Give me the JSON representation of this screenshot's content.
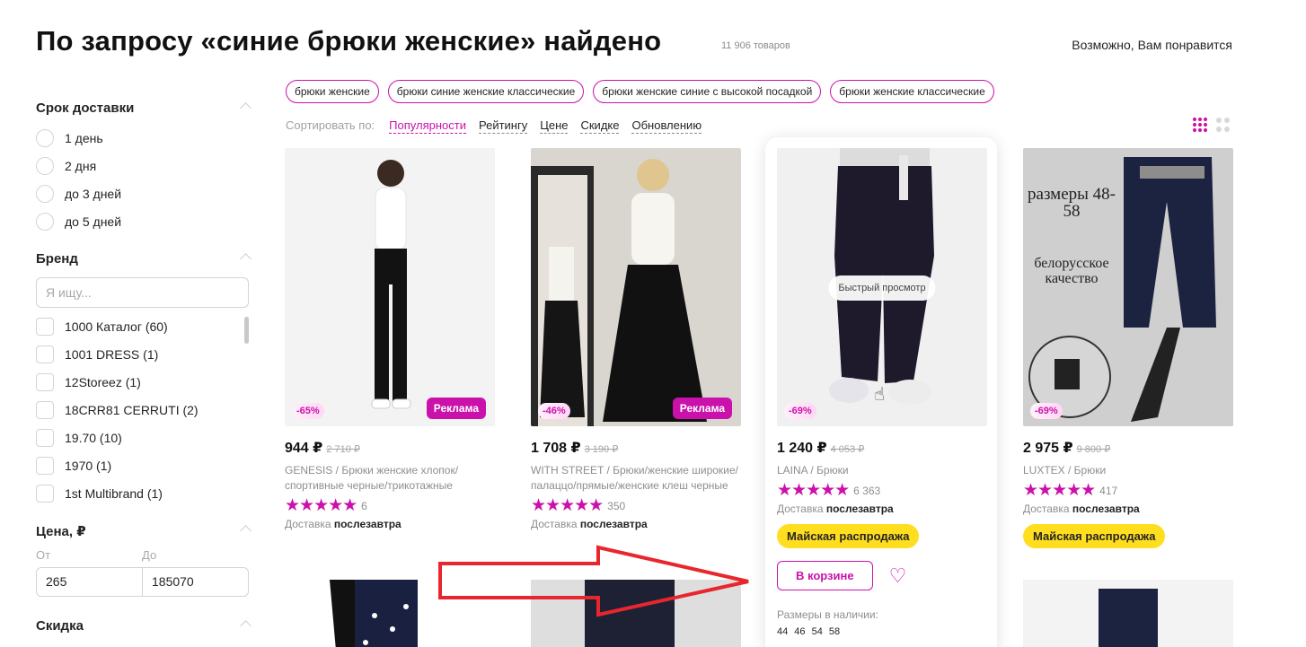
{
  "header": {
    "title": "По запросу «синие брюки женские» найдено",
    "count": "11 906 товаров",
    "maybe_like": "Возможно, Вам понравится"
  },
  "sidebar": {
    "delivery": {
      "title": "Срок доставки",
      "options": [
        "1 день",
        "2 дня",
        "до 3 дней",
        "до 5 дней"
      ]
    },
    "brand": {
      "title": "Бренд",
      "placeholder": "Я ищу...",
      "options": [
        "1000 Каталог (60)",
        "1001 DRESS (1)",
        "12Storeez (1)",
        "18CRR81 CERRUTI (2)",
        "19.70 (10)",
        "1970 (1)",
        "1st Multibrand (1)"
      ]
    },
    "price": {
      "title": "Цена, ₽",
      "from_label": "От",
      "to_label": "До",
      "from_value": "265",
      "to_value": "185070"
    },
    "discount": {
      "title": "Скидка"
    }
  },
  "chips": [
    "брюки женские",
    "брюки синие женские классические",
    "брюки женские синие с высокой посадкой",
    "брюки женские классические"
  ],
  "sort": {
    "label": "Сортировать по:",
    "items": [
      "Популярности",
      "Рейтингу",
      "Цене",
      "Скидке",
      "Обновлению"
    ],
    "active": "Популярности"
  },
  "products": [
    {
      "price": "944 ₽",
      "old_price": "2 710 ₽",
      "discount": "-65%",
      "ad": "Реклама",
      "name": "GENESIS / Брюки женские хлопок/ спортивные черные/трикотажные",
      "stars": "★★★★★",
      "reviews": "6",
      "delivery_label": "Доставка",
      "delivery_value": "послезавтра"
    },
    {
      "price": "1 708 ₽",
      "old_price": "3 190 ₽",
      "discount": "-46%",
      "ad": "Реклама",
      "name": "WITH STREET / Брюки/женские широкие/палаццо/прямые/женские клеш черные",
      "stars": "★★★★★",
      "reviews": "350",
      "delivery_label": "Доставка",
      "delivery_value": "послезавтра"
    },
    {
      "price": "1 240 ₽",
      "old_price": "4 053 ₽",
      "discount": "-69%",
      "quick_view": "Быстрый просмотр",
      "name": "LAINA / Брюки",
      "stars": "★★★★★",
      "reviews": "6 363",
      "delivery_label": "Доставка",
      "delivery_value": "послезавтра",
      "sale": "Майская распродажа",
      "cart": "В корзине",
      "sizes_label": "Размеры в наличии:",
      "sizes": "44 46 54 58"
    },
    {
      "price": "2 975 ₽",
      "old_price": "9 800 ₽",
      "discount": "-69%",
      "banner_top": "размеры 48-58",
      "banner_mid": "белорусское качество",
      "name": "LUXTEX / Брюки",
      "stars": "★★★★★",
      "reviews": "417",
      "delivery_label": "Доставка",
      "delivery_value": "послезавтра",
      "sale": "Майская распродажа"
    }
  ],
  "colors": {
    "accent": "#cb11ab",
    "sale": "#ffdd1f",
    "arrow": "#e8262e"
  }
}
